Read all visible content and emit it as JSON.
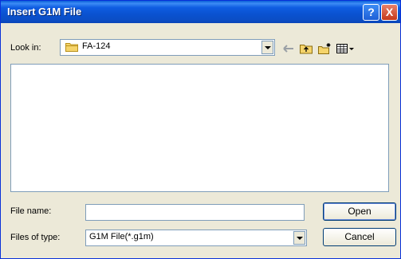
{
  "window": {
    "title": "Insert G1M File"
  },
  "titlebar": {
    "help_glyph": "?",
    "close_glyph": "X"
  },
  "look_in": {
    "label": "Look in:",
    "value": "FA-124"
  },
  "file_name": {
    "label": "File name:",
    "value": ""
  },
  "files_of_type": {
    "label": "Files of type:",
    "value": "G1M File(*.g1m)"
  },
  "buttons": {
    "open": "Open",
    "cancel": "Cancel"
  },
  "toolbar": {
    "icons": [
      "back-arrow-icon",
      "up-folder-icon",
      "new-folder-icon",
      "view-menu-icon"
    ]
  }
}
